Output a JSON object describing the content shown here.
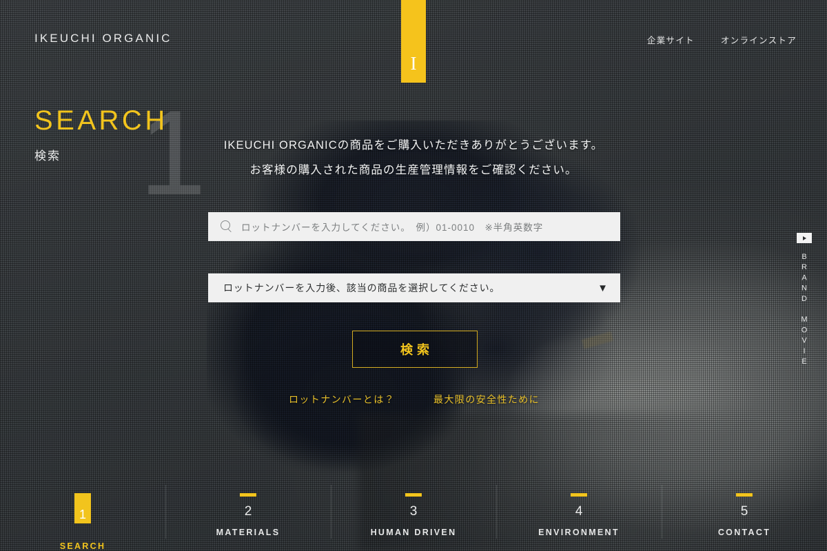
{
  "header": {
    "logo_text": "IKEUCHI ORGANIC",
    "logo_mark_glyph": "I",
    "nav": [
      {
        "label": "企業サイト"
      },
      {
        "label": "オンラインストア"
      }
    ]
  },
  "section": {
    "ghost_number": "1",
    "title_en": "SEARCH",
    "title_ja": "検索"
  },
  "intro": {
    "line1": "IKEUCHI ORGANICの商品をご購入いただきありがとうございます。",
    "line2": "お客様の購入された商品の生産管理情報をご確認ください。"
  },
  "form": {
    "search_icon": "search-icon",
    "search_placeholder": "ロットナンバーを入力してください。　例）01-0010　※半角英数字",
    "search_value": "",
    "select_selected": "ロットナンバーを入力後、該当の商品を選択してください。",
    "select_caret": "▼",
    "submit_label": "検索",
    "links": [
      {
        "label": "ロットナンバーとは？"
      },
      {
        "label": "最大限の安全性ために"
      }
    ]
  },
  "brand_movie": {
    "icon": "play-icon",
    "label": "BRAND MOVIE"
  },
  "bottom_nav": {
    "items": [
      {
        "number": "1",
        "label": "SEARCH",
        "active": true
      },
      {
        "number": "2",
        "label": "MATERIALS",
        "active": false
      },
      {
        "number": "3",
        "label": "HUMAN DRIVEN",
        "active": false
      },
      {
        "number": "4",
        "label": "ENVIRONMENT",
        "active": false
      },
      {
        "number": "5",
        "label": "CONTACT",
        "active": false
      }
    ]
  },
  "colors": {
    "accent_yellow": "#F2C41D",
    "background_gray": "#4B4F53",
    "field_white": "#F0F0F0",
    "text_light": "#ECEDED"
  }
}
